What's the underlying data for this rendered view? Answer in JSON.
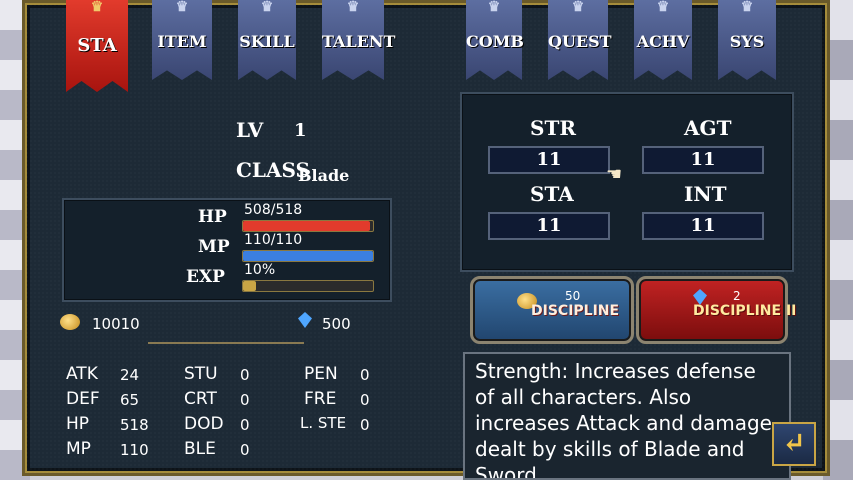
{
  "tabs": [
    {
      "label": "STA",
      "active": true
    },
    {
      "label": "ITEM",
      "active": false
    },
    {
      "label": "SKILL",
      "active": false
    },
    {
      "label": "TALENT",
      "active": false
    },
    {
      "label": "COMB",
      "active": false
    },
    {
      "label": "QUEST",
      "active": false
    },
    {
      "label": "ACHV",
      "active": false
    },
    {
      "label": "SYS",
      "active": false
    }
  ],
  "profile": {
    "lv_label": "LV",
    "lv_value": "1",
    "class_label": "CLASS",
    "class_value": "Blade"
  },
  "bars": {
    "hp": {
      "label": "HP",
      "value": "508/518",
      "fraction": 0.98
    },
    "mp": {
      "label": "MP",
      "value": "110/110",
      "fraction": 1.0
    },
    "exp": {
      "label": "EXP",
      "value": "10%",
      "fraction": 0.1
    }
  },
  "currency": {
    "gold": "10010",
    "gems": "500"
  },
  "attributes": {
    "str": {
      "label": "STR",
      "value": "11"
    },
    "agt": {
      "label": "AGT",
      "value": "11"
    },
    "sta": {
      "label": "STA",
      "value": "11"
    },
    "int": {
      "label": "INT",
      "value": "11"
    }
  },
  "discipline": {
    "left": {
      "label": "DISCIPLINE",
      "cost": "50"
    },
    "right": {
      "label": "DISCIPLINE II",
      "cost": "2"
    }
  },
  "stats": {
    "col1": [
      {
        "label": "ATK",
        "value": "24"
      },
      {
        "label": "DEF",
        "value": "65"
      },
      {
        "label": "HP",
        "value": "518"
      },
      {
        "label": "MP",
        "value": "110"
      }
    ],
    "col2": [
      {
        "label": "STU",
        "value": "0"
      },
      {
        "label": "CRT",
        "value": "0"
      },
      {
        "label": "DOD",
        "value": "0"
      },
      {
        "label": "BLE",
        "value": "0"
      }
    ],
    "col3": [
      {
        "label": "PEN",
        "value": "0"
      },
      {
        "label": "FRE",
        "value": "0"
      },
      {
        "label": "L. STE",
        "value": "0"
      }
    ]
  },
  "description": "Strength: Increases defense of all characters. Also increases Attack and damage dealt by skills of Blade and Sword",
  "colors": {
    "hp": "#e23b2c",
    "mp": "#3b7fe0",
    "accent": "#c9a545"
  }
}
